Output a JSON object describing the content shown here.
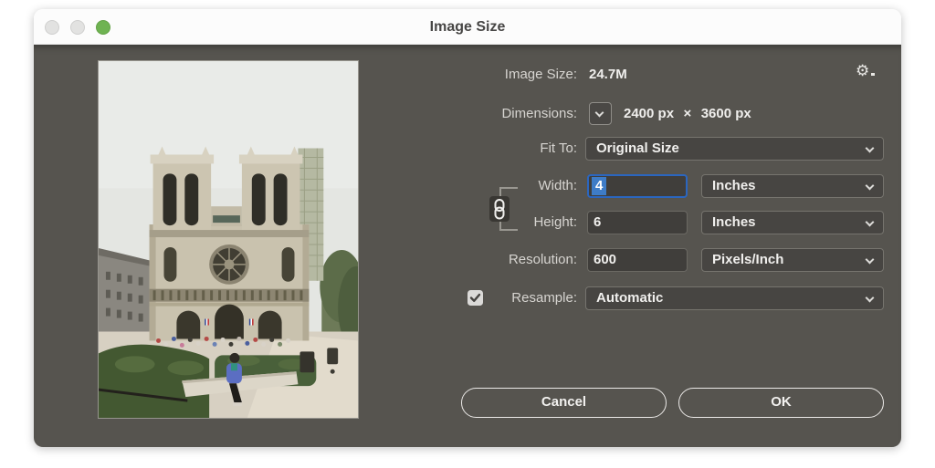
{
  "window": {
    "title": "Image Size"
  },
  "preview": {
    "description": "Photo of Notre-Dame cathedral, Paris"
  },
  "panel": {
    "image_size": {
      "label": "Image Size:",
      "value": "24.7M"
    },
    "dimensions": {
      "label": "Dimensions:",
      "value_width": "2400 px",
      "times": "×",
      "value_height": "3600 px"
    },
    "fit_to": {
      "label": "Fit To:",
      "value": "Original Size"
    },
    "width": {
      "label": "Width:",
      "value": "4",
      "unit": "Inches"
    },
    "height": {
      "label": "Height:",
      "value": "6",
      "unit": "Inches"
    },
    "resolution": {
      "label": "Resolution:",
      "value": "600",
      "unit": "Pixels/Inch"
    },
    "resample": {
      "label": "Resample:",
      "value": "Automatic",
      "checked": true
    },
    "buttons": {
      "cancel": "Cancel",
      "ok": "OK"
    }
  },
  "icons": {
    "gear": "⚙"
  },
  "colors": {
    "dialog_bg": "#56544F",
    "field_bg": "#474542",
    "input_bg": "#403E3B",
    "accent_blue": "#3E7CC7",
    "focus_border": "#2B66BF",
    "traffic_green": "#6FB352",
    "label_text": "#D6D4D0",
    "value_text": "#F0EFED"
  }
}
